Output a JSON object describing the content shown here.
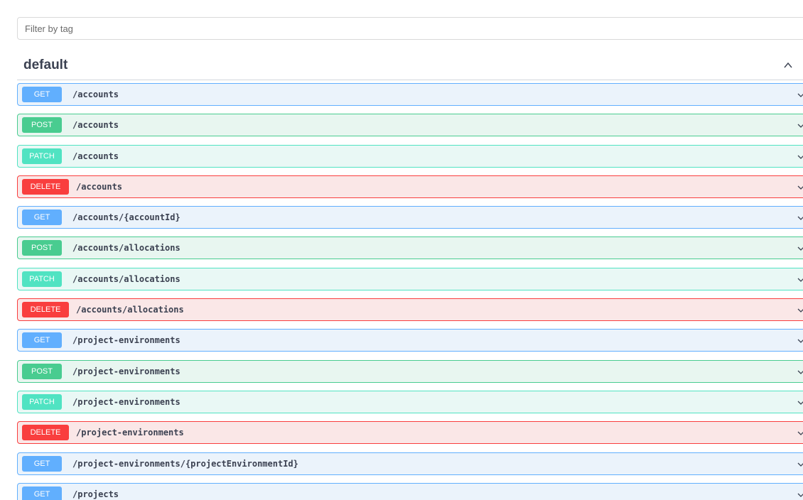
{
  "filter": {
    "placeholder": "Filter by tag"
  },
  "tag": {
    "name": "default",
    "toggle_icon": "chevron-up-icon"
  },
  "colors": {
    "get": "#61affe",
    "post": "#49cc90",
    "patch": "#50e3c2",
    "delete": "#f93e3e",
    "text": "#3b4151"
  },
  "operations": [
    {
      "method": "GET",
      "path": "/accounts"
    },
    {
      "method": "POST",
      "path": "/accounts"
    },
    {
      "method": "PATCH",
      "path": "/accounts"
    },
    {
      "method": "DELETE",
      "path": "/accounts"
    },
    {
      "method": "GET",
      "path": "/accounts/{accountId}"
    },
    {
      "method": "POST",
      "path": "/accounts/allocations"
    },
    {
      "method": "PATCH",
      "path": "/accounts/allocations"
    },
    {
      "method": "DELETE",
      "path": "/accounts/allocations"
    },
    {
      "method": "GET",
      "path": "/project-environments"
    },
    {
      "method": "POST",
      "path": "/project-environments"
    },
    {
      "method": "PATCH",
      "path": "/project-environments"
    },
    {
      "method": "DELETE",
      "path": "/project-environments"
    },
    {
      "method": "GET",
      "path": "/project-environments/{projectEnvironmentId}"
    },
    {
      "method": "GET",
      "path": "/projects"
    }
  ]
}
